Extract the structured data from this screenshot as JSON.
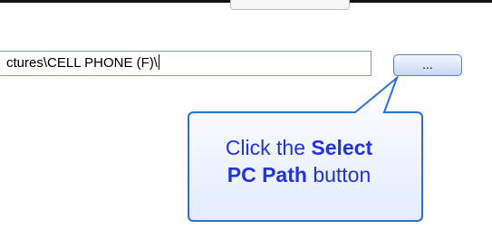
{
  "dialog": {
    "path_value": "ctures\\CELL PHONE (F)\\",
    "browse_label": "..."
  },
  "callout": {
    "prefix": "Click the",
    "emphasis_1": "Select",
    "emphasis_2": "PC Path",
    "suffix": "button"
  },
  "colors": {
    "callout_border": "#2f6fd2",
    "callout_text": "#2233dd",
    "field_border": "#7f9db9"
  },
  "icons": {
    "callout_pointer": "speech-bubble-pointer"
  }
}
